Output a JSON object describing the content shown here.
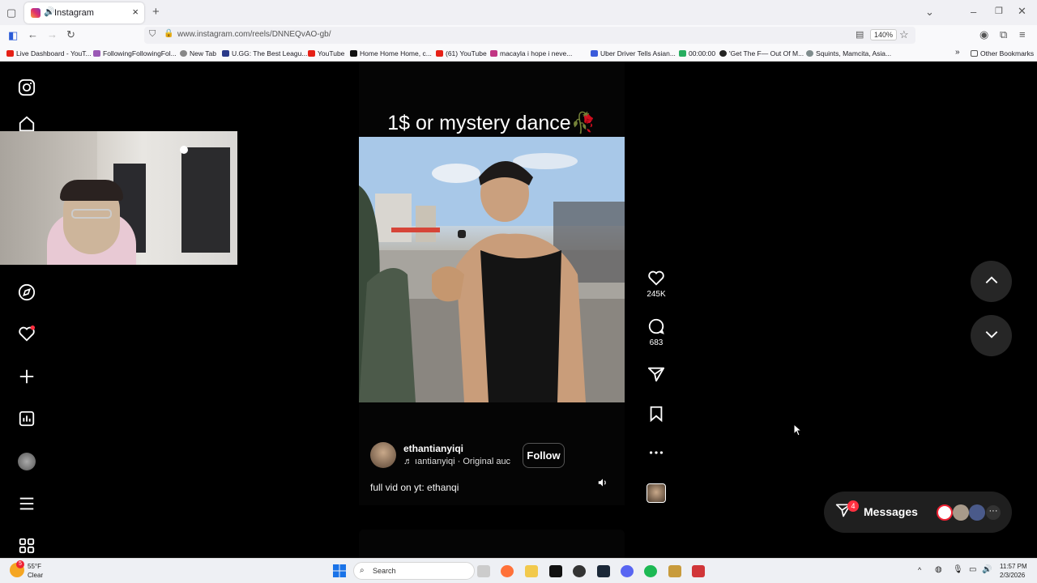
{
  "browser": {
    "tab_title": "Instagram",
    "url": "www.instagram.com/reels/DNNEQvAO-gb/",
    "zoom": "140%",
    "new_tab_symbol": "+",
    "tab_close_symbol": "×"
  },
  "bookmarks": [
    {
      "label": "Live Dashboard - YouT...",
      "color": "#e62117"
    },
    {
      "label": "FollowingFollowingFol...",
      "color": "#9b59b6"
    },
    {
      "label": "New Tab",
      "color": "#888888"
    },
    {
      "label": "U.GG: The Best Leagu...",
      "color": "#2a3a8a"
    },
    {
      "label": "YouTube",
      "color": "#e62117"
    },
    {
      "label": "Home Home Home, c...",
      "color": "#111111"
    },
    {
      "label": "(61) YouTube",
      "color": "#e62117"
    },
    {
      "label": "macayla i hope i neve...",
      "color": "#c13584"
    },
    {
      "label": "Uber Driver Tells Asian...",
      "color": "#3b5bdb"
    },
    {
      "label": "00:00:00",
      "color": "#e67e22"
    },
    {
      "label": "00:00:00",
      "color": "#27ae60"
    },
    {
      "label": "'Get The F— Out Of M...",
      "color": "#222222"
    },
    {
      "label": "Squints, Mamcita, Asia...",
      "color": "#7f8c8d"
    }
  ],
  "other_bookmarks": "Other Bookmarks",
  "reel": {
    "title": "1$ or mystery dance🥀",
    "username": "ethantianyiqi",
    "audio": "♬ ıantianyiqi · Original auc",
    "follow_label": "Follow",
    "caption": "full vid on yt: ethanqi",
    "likes": "245K",
    "comments": "683"
  },
  "messages": {
    "label": "Messages",
    "badge": "4"
  },
  "taskbar": {
    "weather_temp": "55°F",
    "weather_desc": "Clear",
    "weather_badge": "5",
    "search_placeholder": "Search",
    "time": "11:57 PM",
    "date": "2/3/2026"
  }
}
